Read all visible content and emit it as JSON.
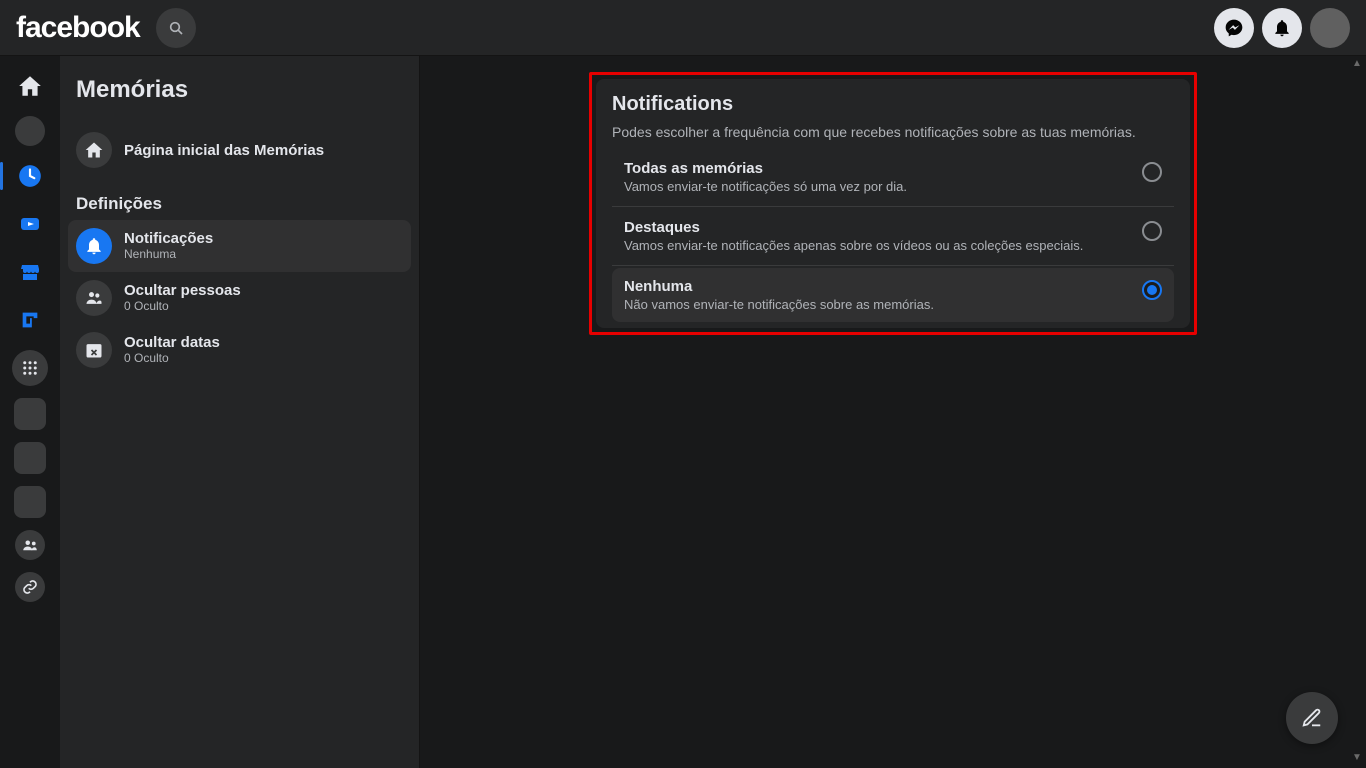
{
  "header": {
    "logo_text": "facebook"
  },
  "sidebar": {
    "title": "Memórias",
    "home_item": {
      "label": "Página inicial das Memórias"
    },
    "section_label": "Definições",
    "items": [
      {
        "label": "Notificações",
        "sub": "Nenhuma",
        "active": true
      },
      {
        "label": "Ocultar pessoas",
        "sub": "0 Oculto"
      },
      {
        "label": "Ocultar datas",
        "sub": "0 Oculto"
      }
    ]
  },
  "notifications": {
    "title": "Notifications",
    "description": "Podes escolher a frequência com que recebes notificações sobre as tuas memórias.",
    "options": [
      {
        "title": "Todas as memórias",
        "desc": "Vamos enviar-te notificações só uma vez por dia.",
        "selected": false
      },
      {
        "title": "Destaques",
        "desc": "Vamos enviar-te notificações apenas sobre os vídeos ou as coleções especiais.",
        "selected": false
      },
      {
        "title": "Nenhuma",
        "desc": "Não vamos enviar-te notificações sobre as memórias.",
        "selected": true
      }
    ]
  }
}
